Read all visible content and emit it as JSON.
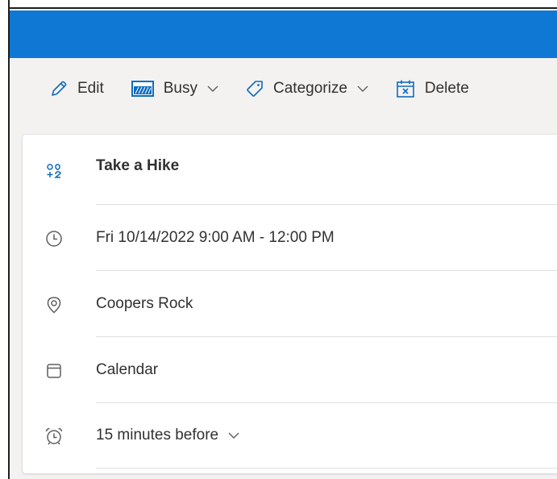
{
  "toolbar": {
    "edit_label": "Edit",
    "busy_label": "Busy",
    "categorize_label": "Categorize",
    "delete_label": "Delete"
  },
  "event": {
    "title": "Take a Hike",
    "datetime": "Fri 10/14/2022 9:00 AM - 12:00 PM",
    "location": "Coopers Rock",
    "calendar": "Calendar",
    "reminder": "15 minutes before"
  },
  "colors": {
    "accent": "#0f78d4",
    "icon_blue": "#0f6cbd",
    "text": "#323130",
    "toolbar_bg": "#f3f2f1"
  },
  "icons": {
    "edit": "pencil-icon",
    "busy": "busy-status-icon",
    "categorize": "tag-icon",
    "delete": "calendar-delete-icon",
    "title": "group-activity-icon",
    "time": "clock-icon",
    "location": "location-pin-icon",
    "calendar": "calendar-icon",
    "reminder": "alarm-clock-icon"
  }
}
